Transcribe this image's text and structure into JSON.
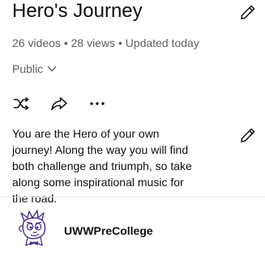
{
  "playlist": {
    "title": "Hero's Journey",
    "meta": "26 videos • 28 views • Updated today",
    "privacy": "Public",
    "description": "You are the Hero of your own journey! Along the way you will find both challenge and triumph, so take along some inspirational music for the road."
  },
  "channel": {
    "name": "UWWPreCollege"
  },
  "icons": {
    "edit_title": "pencil-icon",
    "edit_description": "pencil-icon",
    "privacy_dropdown": "chevron-down-icon",
    "shuffle": "shuffle-icon",
    "share": "share-icon",
    "more": "more-horizontal-icon"
  },
  "colors": {
    "text_primary": "#0f0f0f",
    "text_secondary": "#606060",
    "avatar_accent": "#4b2f8a"
  }
}
